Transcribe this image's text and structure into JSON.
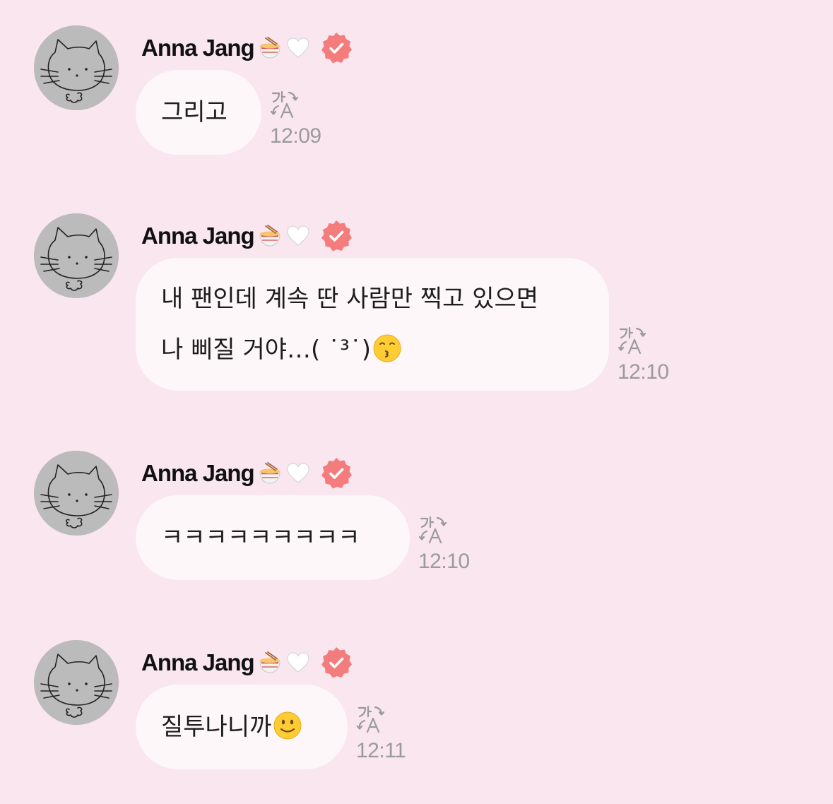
{
  "chat": {
    "sender_name": "Anna Jang",
    "name_emoji_1": "noodle-bowl-emoji",
    "name_emoji_2": "white-heart-emoji",
    "verified_badge": "verified-badge-icon",
    "accent_color": "#f47c7c",
    "background_color": "#f9e6ef",
    "bubble_color": "#fef7fa",
    "messages": [
      {
        "lines": [
          "그리고"
        ],
        "emoji": "",
        "time": "12:09"
      },
      {
        "lines": [
          "내 팬인데 계속 딴 사람만 찍고 있으면",
          "나 삐질 거야…( ˙³˙)"
        ],
        "emoji": "kissing-face-emoji",
        "time": "12:10"
      },
      {
        "lines": [
          "ㅋㅋㅋㅋㅋㅋㅋㅋㅋ"
        ],
        "emoji": "",
        "time": "12:10"
      },
      {
        "lines": [
          "질투나니까"
        ],
        "emoji": "slightly-smiling-face-emoji",
        "time": "12:11"
      }
    ]
  }
}
